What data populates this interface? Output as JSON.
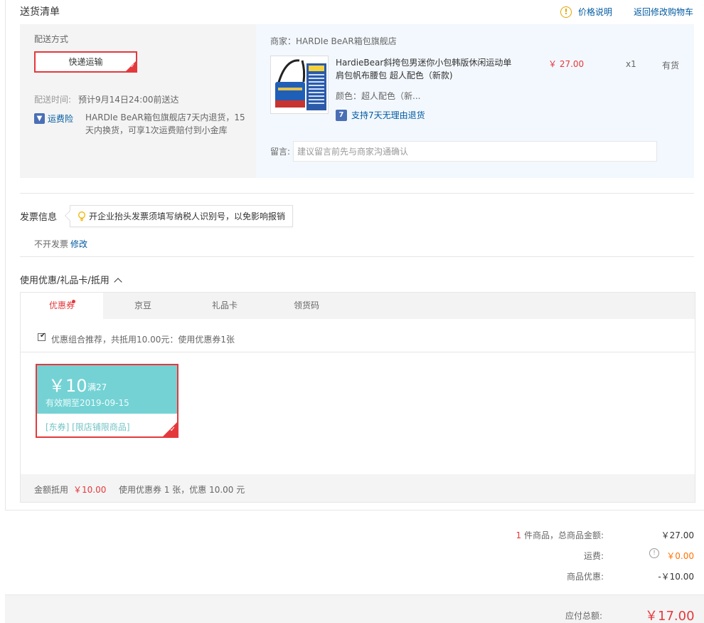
{
  "header": {
    "title": "送货清单",
    "price_help": "价格说明",
    "back_to_cart": "返回修改购物车"
  },
  "delivery": {
    "label": "配送方式",
    "method": "快递运输",
    "time_label": "配送时间:",
    "time_value": "预计9月14日24:00前送达",
    "insurance_label": "运费险",
    "insurance_desc": "HARDIe BeAR箱包旗舰店7天内退货，15天内换货，可享1次运费赔付到小金库"
  },
  "shop": {
    "name": "商家：HARDIe BeAR箱包旗舰店",
    "product": {
      "name": "HardieBear斜挎包男迷你小包韩版休闲运动单肩包帆布腰包 超人配色（新款)",
      "price": "￥ 27.00",
      "qty": "x1",
      "stock": "有货",
      "color": "颜色：超人配色（新...",
      "return_policy": "支持7天无理由退货"
    },
    "message_label": "留言:",
    "message_placeholder": "建议留言前先与商家沟通确认"
  },
  "invoice": {
    "title": "发票信息",
    "tip": "开企业抬头发票须填写纳税人识别号，以免影响报销",
    "value": "不开发票",
    "edit": "修改"
  },
  "coupons": {
    "heading": "使用优惠/礼品卡/抵用",
    "tabs": [
      "优惠券",
      "京豆",
      "礼品卡",
      "领货码"
    ],
    "combo_text": "优惠组合推荐，共抵用10.00元：使用优惠券1张",
    "combo_checked": true,
    "card": {
      "amount": "￥10",
      "condition": "满27",
      "expiry": "有效期至2019-09-15",
      "tags": "[东券]  [限店铺限商品]",
      "accent_color": "#74d2d4"
    },
    "summary_label": "金额抵用",
    "summary_amount": "￥10.00",
    "summary_text": "使用优惠券 1 张，优惠 10.00 元"
  },
  "totals": {
    "goods_count": "1",
    "goods_label": "件商品，总商品金额:",
    "goods_value": "￥27.00",
    "shipping_label": "运费:",
    "shipping_value": "￥0.00",
    "discount_label": "商品优惠:",
    "discount_value": "-￥10.00",
    "payable_label": "应付总额:",
    "payable_value": "￥17.00"
  },
  "colors": {
    "accent": "#e4393c",
    "link": "#005aa0",
    "coupon": "#74d2d4"
  }
}
